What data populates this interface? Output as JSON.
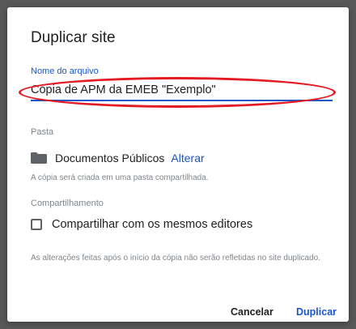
{
  "dialog": {
    "title": "Duplicar site",
    "file_name": {
      "label": "Nome do arquivo",
      "value": "Cópia de APM da EMEB \"Exemplo\""
    },
    "folder": {
      "label": "Pasta",
      "icon": "folder-icon",
      "name": "Documentos Públicos",
      "change_link": "Alterar",
      "hint": "A cópia será criada em uma pasta compartilhada."
    },
    "sharing": {
      "label": "Compartilhamento",
      "checkbox_label": "Compartilhar com os mesmos editores",
      "checked": false
    },
    "note": "As alterações feitas após o início da cópia não serão refletidas no site duplicado.",
    "buttons": {
      "cancel": "Cancelar",
      "duplicate": "Duplicar"
    },
    "colors": {
      "accent": "#1a56c8",
      "highlight": "#e31b23"
    }
  }
}
